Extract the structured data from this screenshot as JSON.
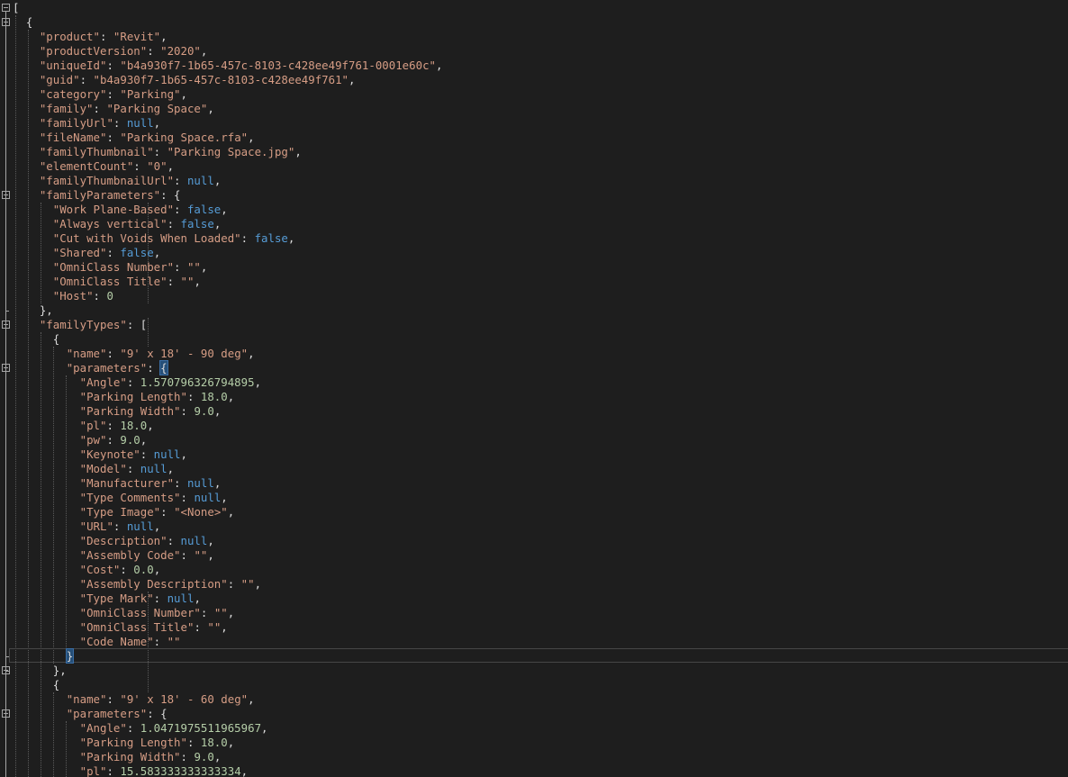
{
  "editor": {
    "lines": [
      [
        {
          "t": "[",
          "c": "p"
        }
      ],
      [
        {
          "t": "  {",
          "c": "p"
        }
      ],
      [
        {
          "t": "    ",
          "c": "p"
        },
        {
          "t": "\"product\"",
          "c": "k"
        },
        {
          "t": ": ",
          "c": "p"
        },
        {
          "t": "\"Revit\"",
          "c": "s"
        },
        {
          "t": ",",
          "c": "p"
        }
      ],
      [
        {
          "t": "    ",
          "c": "p"
        },
        {
          "t": "\"productVersion\"",
          "c": "k"
        },
        {
          "t": ": ",
          "c": "p"
        },
        {
          "t": "\"2020\"",
          "c": "s"
        },
        {
          "t": ",",
          "c": "p"
        }
      ],
      [
        {
          "t": "    ",
          "c": "p"
        },
        {
          "t": "\"uniqueId\"",
          "c": "k"
        },
        {
          "t": ": ",
          "c": "p"
        },
        {
          "t": "\"b4a930f7-1b65-457c-8103-c428ee49f761-0001e60c\"",
          "c": "s"
        },
        {
          "t": ",",
          "c": "p"
        }
      ],
      [
        {
          "t": "    ",
          "c": "p"
        },
        {
          "t": "\"guid\"",
          "c": "k"
        },
        {
          "t": ": ",
          "c": "p"
        },
        {
          "t": "\"b4a930f7-1b65-457c-8103-c428ee49f761\"",
          "c": "s"
        },
        {
          "t": ",",
          "c": "p"
        }
      ],
      [
        {
          "t": "    ",
          "c": "p"
        },
        {
          "t": "\"category\"",
          "c": "k"
        },
        {
          "t": ": ",
          "c": "p"
        },
        {
          "t": "\"Parking\"",
          "c": "s"
        },
        {
          "t": ",",
          "c": "p"
        }
      ],
      [
        {
          "t": "    ",
          "c": "p"
        },
        {
          "t": "\"family\"",
          "c": "k"
        },
        {
          "t": ": ",
          "c": "p"
        },
        {
          "t": "\"Parking Space\"",
          "c": "s"
        },
        {
          "t": ",",
          "c": "p"
        }
      ],
      [
        {
          "t": "    ",
          "c": "p"
        },
        {
          "t": "\"familyUrl\"",
          "c": "k"
        },
        {
          "t": ": ",
          "c": "p"
        },
        {
          "t": "null",
          "c": "lit"
        },
        {
          "t": ",",
          "c": "p"
        }
      ],
      [
        {
          "t": "    ",
          "c": "p"
        },
        {
          "t": "\"fileName\"",
          "c": "k"
        },
        {
          "t": ": ",
          "c": "p"
        },
        {
          "t": "\"Parking Space.rfa\"",
          "c": "s"
        },
        {
          "t": ",",
          "c": "p"
        }
      ],
      [
        {
          "t": "    ",
          "c": "p"
        },
        {
          "t": "\"familyThumbnail\"",
          "c": "k"
        },
        {
          "t": ": ",
          "c": "p"
        },
        {
          "t": "\"Parking Space.jpg\"",
          "c": "s"
        },
        {
          "t": ",",
          "c": "p"
        }
      ],
      [
        {
          "t": "    ",
          "c": "p"
        },
        {
          "t": "\"elementCount\"",
          "c": "k"
        },
        {
          "t": ": ",
          "c": "p"
        },
        {
          "t": "\"0\"",
          "c": "s"
        },
        {
          "t": ",",
          "c": "p"
        }
      ],
      [
        {
          "t": "    ",
          "c": "p"
        },
        {
          "t": "\"familyThumbnailUrl\"",
          "c": "k"
        },
        {
          "t": ": ",
          "c": "p"
        },
        {
          "t": "null",
          "c": "lit"
        },
        {
          "t": ",",
          "c": "p"
        }
      ],
      [
        {
          "t": "    ",
          "c": "p"
        },
        {
          "t": "\"familyParameters\"",
          "c": "k"
        },
        {
          "t": ": {",
          "c": "p"
        }
      ],
      [
        {
          "t": "      ",
          "c": "p"
        },
        {
          "t": "\"Work Plane-Based\"",
          "c": "k"
        },
        {
          "t": ": ",
          "c": "p"
        },
        {
          "t": "false",
          "c": "lit"
        },
        {
          "t": ",",
          "c": "p"
        }
      ],
      [
        {
          "t": "      ",
          "c": "p"
        },
        {
          "t": "\"Always vertical\"",
          "c": "k"
        },
        {
          "t": ": ",
          "c": "p"
        },
        {
          "t": "false",
          "c": "lit"
        },
        {
          "t": ",",
          "c": "p"
        }
      ],
      [
        {
          "t": "      ",
          "c": "p"
        },
        {
          "t": "\"Cut with Voids When Loaded\"",
          "c": "k"
        },
        {
          "t": ": ",
          "c": "p"
        },
        {
          "t": "false",
          "c": "lit"
        },
        {
          "t": ",",
          "c": "p"
        }
      ],
      [
        {
          "t": "      ",
          "c": "p"
        },
        {
          "t": "\"Shared\"",
          "c": "k"
        },
        {
          "t": ": ",
          "c": "p"
        },
        {
          "t": "false",
          "c": "lit"
        },
        {
          "t": ",",
          "c": "p"
        }
      ],
      [
        {
          "t": "      ",
          "c": "p"
        },
        {
          "t": "\"OmniClass Number\"",
          "c": "k"
        },
        {
          "t": ": ",
          "c": "p"
        },
        {
          "t": "\"\"",
          "c": "s"
        },
        {
          "t": ",",
          "c": "p"
        }
      ],
      [
        {
          "t": "      ",
          "c": "p"
        },
        {
          "t": "\"OmniClass Title\"",
          "c": "k"
        },
        {
          "t": ": ",
          "c": "p"
        },
        {
          "t": "\"\"",
          "c": "s"
        },
        {
          "t": ",",
          "c": "p"
        }
      ],
      [
        {
          "t": "      ",
          "c": "p"
        },
        {
          "t": "\"Host\"",
          "c": "k"
        },
        {
          "t": ": ",
          "c": "p"
        },
        {
          "t": "0",
          "c": "n"
        }
      ],
      [
        {
          "t": "    },",
          "c": "p"
        }
      ],
      [
        {
          "t": "    ",
          "c": "p"
        },
        {
          "t": "\"familyTypes\"",
          "c": "k"
        },
        {
          "t": ": [",
          "c": "p"
        }
      ],
      [
        {
          "t": "      {",
          "c": "p"
        }
      ],
      [
        {
          "t": "        ",
          "c": "p"
        },
        {
          "t": "\"name\"",
          "c": "k"
        },
        {
          "t": ": ",
          "c": "p"
        },
        {
          "t": "\"9' x 18' - 90 deg\"",
          "c": "s"
        },
        {
          "t": ",",
          "c": "p"
        }
      ],
      [
        {
          "t": "        ",
          "c": "p"
        },
        {
          "t": "\"parameters\"",
          "c": "k"
        },
        {
          "t": ": ",
          "c": "p"
        },
        {
          "t": "{",
          "c": "bm"
        }
      ],
      [
        {
          "t": "          ",
          "c": "p"
        },
        {
          "t": "\"Angle\"",
          "c": "k"
        },
        {
          "t": ": ",
          "c": "p"
        },
        {
          "t": "1.570796326794895",
          "c": "n"
        },
        {
          "t": ",",
          "c": "p"
        }
      ],
      [
        {
          "t": "          ",
          "c": "p"
        },
        {
          "t": "\"Parking Length\"",
          "c": "k"
        },
        {
          "t": ": ",
          "c": "p"
        },
        {
          "t": "18.0",
          "c": "n"
        },
        {
          "t": ",",
          "c": "p"
        }
      ],
      [
        {
          "t": "          ",
          "c": "p"
        },
        {
          "t": "\"Parking Width\"",
          "c": "k"
        },
        {
          "t": ": ",
          "c": "p"
        },
        {
          "t": "9.0",
          "c": "n"
        },
        {
          "t": ",",
          "c": "p"
        }
      ],
      [
        {
          "t": "          ",
          "c": "p"
        },
        {
          "t": "\"pl\"",
          "c": "k"
        },
        {
          "t": ": ",
          "c": "p"
        },
        {
          "t": "18.0",
          "c": "n"
        },
        {
          "t": ",",
          "c": "p"
        }
      ],
      [
        {
          "t": "          ",
          "c": "p"
        },
        {
          "t": "\"pw\"",
          "c": "k"
        },
        {
          "t": ": ",
          "c": "p"
        },
        {
          "t": "9.0",
          "c": "n"
        },
        {
          "t": ",",
          "c": "p"
        }
      ],
      [
        {
          "t": "          ",
          "c": "p"
        },
        {
          "t": "\"Keynote\"",
          "c": "k"
        },
        {
          "t": ": ",
          "c": "p"
        },
        {
          "t": "null",
          "c": "lit"
        },
        {
          "t": ",",
          "c": "p"
        }
      ],
      [
        {
          "t": "          ",
          "c": "p"
        },
        {
          "t": "\"Model\"",
          "c": "k"
        },
        {
          "t": ": ",
          "c": "p"
        },
        {
          "t": "null",
          "c": "lit"
        },
        {
          "t": ",",
          "c": "p"
        }
      ],
      [
        {
          "t": "          ",
          "c": "p"
        },
        {
          "t": "\"Manufacturer\"",
          "c": "k"
        },
        {
          "t": ": ",
          "c": "p"
        },
        {
          "t": "null",
          "c": "lit"
        },
        {
          "t": ",",
          "c": "p"
        }
      ],
      [
        {
          "t": "          ",
          "c": "p"
        },
        {
          "t": "\"Type Comments\"",
          "c": "k"
        },
        {
          "t": ": ",
          "c": "p"
        },
        {
          "t": "null",
          "c": "lit"
        },
        {
          "t": ",",
          "c": "p"
        }
      ],
      [
        {
          "t": "          ",
          "c": "p"
        },
        {
          "t": "\"Type Image\"",
          "c": "k"
        },
        {
          "t": ": ",
          "c": "p"
        },
        {
          "t": "\"<None>\"",
          "c": "s"
        },
        {
          "t": ",",
          "c": "p"
        }
      ],
      [
        {
          "t": "          ",
          "c": "p"
        },
        {
          "t": "\"URL\"",
          "c": "k"
        },
        {
          "t": ": ",
          "c": "p"
        },
        {
          "t": "null",
          "c": "lit"
        },
        {
          "t": ",",
          "c": "p"
        }
      ],
      [
        {
          "t": "          ",
          "c": "p"
        },
        {
          "t": "\"Description\"",
          "c": "k"
        },
        {
          "t": ": ",
          "c": "p"
        },
        {
          "t": "null",
          "c": "lit"
        },
        {
          "t": ",",
          "c": "p"
        }
      ],
      [
        {
          "t": "          ",
          "c": "p"
        },
        {
          "t": "\"Assembly Code\"",
          "c": "k"
        },
        {
          "t": ": ",
          "c": "p"
        },
        {
          "t": "\"\"",
          "c": "s"
        },
        {
          "t": ",",
          "c": "p"
        }
      ],
      [
        {
          "t": "          ",
          "c": "p"
        },
        {
          "t": "\"Cost\"",
          "c": "k"
        },
        {
          "t": ": ",
          "c": "p"
        },
        {
          "t": "0.0",
          "c": "n"
        },
        {
          "t": ",",
          "c": "p"
        }
      ],
      [
        {
          "t": "          ",
          "c": "p"
        },
        {
          "t": "\"Assembly Description\"",
          "c": "k"
        },
        {
          "t": ": ",
          "c": "p"
        },
        {
          "t": "\"\"",
          "c": "s"
        },
        {
          "t": ",",
          "c": "p"
        }
      ],
      [
        {
          "t": "          ",
          "c": "p"
        },
        {
          "t": "\"Type Mark\"",
          "c": "k"
        },
        {
          "t": ": ",
          "c": "p"
        },
        {
          "t": "null",
          "c": "lit"
        },
        {
          "t": ",",
          "c": "p"
        }
      ],
      [
        {
          "t": "          ",
          "c": "p"
        },
        {
          "t": "\"OmniClass Number\"",
          "c": "k"
        },
        {
          "t": ": ",
          "c": "p"
        },
        {
          "t": "\"\"",
          "c": "s"
        },
        {
          "t": ",",
          "c": "p"
        }
      ],
      [
        {
          "t": "          ",
          "c": "p"
        },
        {
          "t": "\"OmniClass Title\"",
          "c": "k"
        },
        {
          "t": ": ",
          "c": "p"
        },
        {
          "t": "\"\"",
          "c": "s"
        },
        {
          "t": ",",
          "c": "p"
        }
      ],
      [
        {
          "t": "          ",
          "c": "p"
        },
        {
          "t": "\"Code Name\"",
          "c": "k"
        },
        {
          "t": ": ",
          "c": "p"
        },
        {
          "t": "\"\"",
          "c": "s"
        }
      ],
      [
        {
          "t": "        ",
          "c": "p"
        },
        {
          "t": "}",
          "c": "bm"
        }
      ],
      [
        {
          "t": "      },",
          "c": "p"
        }
      ],
      [
        {
          "t": "      {",
          "c": "p"
        }
      ],
      [
        {
          "t": "        ",
          "c": "p"
        },
        {
          "t": "\"name\"",
          "c": "k"
        },
        {
          "t": ": ",
          "c": "p"
        },
        {
          "t": "\"9' x 18' - 60 deg\"",
          "c": "s"
        },
        {
          "t": ",",
          "c": "p"
        }
      ],
      [
        {
          "t": "        ",
          "c": "p"
        },
        {
          "t": "\"parameters\"",
          "c": "k"
        },
        {
          "t": ": {",
          "c": "p"
        }
      ],
      [
        {
          "t": "          ",
          "c": "p"
        },
        {
          "t": "\"Angle\"",
          "c": "k"
        },
        {
          "t": ": ",
          "c": "p"
        },
        {
          "t": "1.0471975511965967",
          "c": "n"
        },
        {
          "t": ",",
          "c": "p"
        }
      ],
      [
        {
          "t": "          ",
          "c": "p"
        },
        {
          "t": "\"Parking Length\"",
          "c": "k"
        },
        {
          "t": ": ",
          "c": "p"
        },
        {
          "t": "18.0",
          "c": "n"
        },
        {
          "t": ",",
          "c": "p"
        }
      ],
      [
        {
          "t": "          ",
          "c": "p"
        },
        {
          "t": "\"Parking Width\"",
          "c": "k"
        },
        {
          "t": ": ",
          "c": "p"
        },
        {
          "t": "9.0",
          "c": "n"
        },
        {
          "t": ",",
          "c": "p"
        }
      ],
      [
        {
          "t": "          ",
          "c": "p"
        },
        {
          "t": "\"pl\"",
          "c": "k"
        },
        {
          "t": ": ",
          "c": "p"
        },
        {
          "t": "15.583333333333334",
          "c": "n"
        },
        {
          "t": ",",
          "c": "p"
        }
      ]
    ],
    "fold_markers": [
      0,
      1,
      13,
      22,
      25,
      46,
      49
    ],
    "current_line": 45,
    "colors": {
      "background": "#1e1e1e",
      "string": "#d69d85",
      "number": "#b5cea8",
      "keyword": "#569cd6",
      "punctuation": "#dcdcdc"
    }
  }
}
